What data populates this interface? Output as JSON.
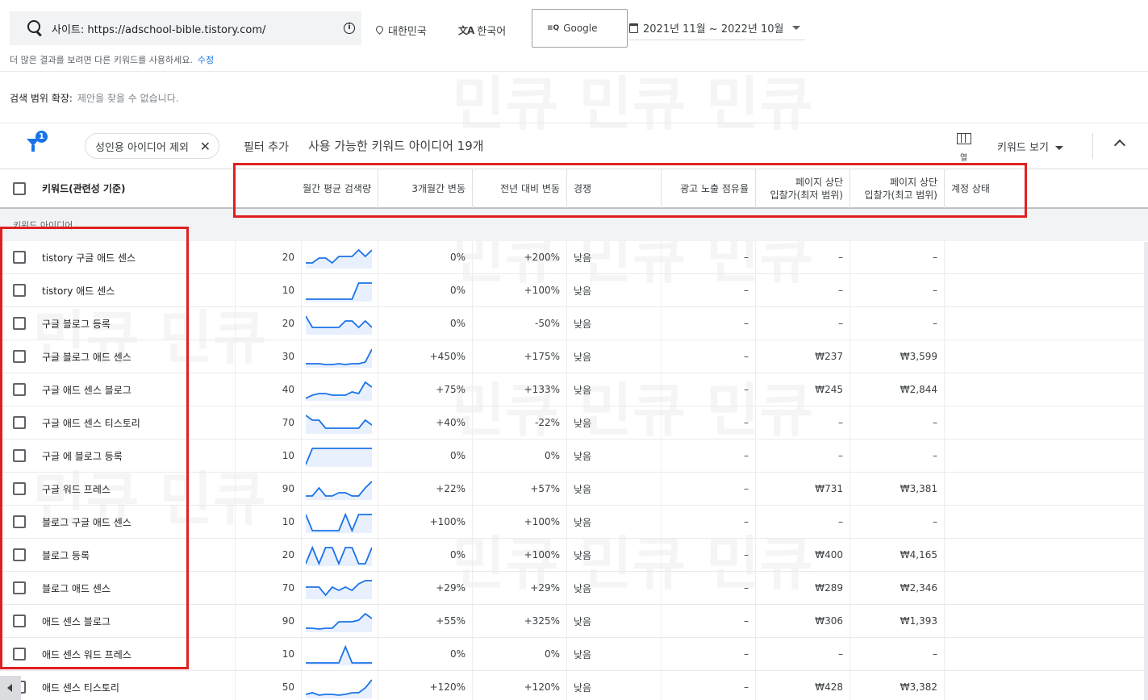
{
  "search": {
    "site_text": "사이트: https://adschool-bible.tistory.com/"
  },
  "location": "대한민국",
  "language": "한국어",
  "engine": "Google",
  "date_range": "2021년 11월 ~ 2022년 10월",
  "hint": {
    "text": "더 많은 결과를 보려면 다른 키워드를 사용하세요.",
    "link": "수정"
  },
  "expand": {
    "label": "검색 범위 확장:",
    "value": "제안을 찾을 수 없습니다."
  },
  "filterbar": {
    "badge": "1",
    "chip_label": "성인용 아이디어 제외",
    "add_filter": "필터 추가",
    "ideas_count": "사용 가능한 키워드 아이디어 19개",
    "columns_label": "열",
    "keyword_view": "키워드 보기"
  },
  "table": {
    "headers": {
      "keyword": "키워드(관련성 기준)",
      "volume": "월간 평균 검색량",
      "change_3m": "3개월간 변동",
      "change_yoy": "전년 대비 변동",
      "competition": "경쟁",
      "impression_share": "광고 노출 점유율",
      "bid_low_1": "페이지 상단",
      "bid_low_2": "입찰가(최저 범위)",
      "bid_high_1": "페이지 상단",
      "bid_high_2": "입찰가(최고 범위)",
      "account_status": "계정 상태"
    },
    "group_label": "키워드 아이디어",
    "rows": [
      {
        "keyword": "tistory 구글 애드 센스",
        "volume": "20",
        "change_3m": "0%",
        "change_yoy": "+200%",
        "competition": "낮음",
        "impression": "–",
        "bid_low": "–",
        "bid_high": "–",
        "trend": [
          0.2,
          0.2,
          0.5,
          0.5,
          0.2,
          0.6,
          0.6,
          0.6,
          1.0,
          0.6,
          1.0
        ]
      },
      {
        "keyword": "tistory 애드 센스",
        "volume": "10",
        "change_3m": "0%",
        "change_yoy": "+100%",
        "competition": "낮음",
        "impression": "–",
        "bid_low": "–",
        "bid_high": "–",
        "trend": [
          0,
          0,
          0,
          0,
          0,
          0,
          0,
          0,
          1,
          1,
          1
        ]
      },
      {
        "keyword": "구글 블로그 등록",
        "volume": "20",
        "change_3m": "0%",
        "change_yoy": "-50%",
        "competition": "낮음",
        "impression": "–",
        "bid_low": "–",
        "bid_high": "–",
        "trend": [
          1,
          0.3,
          0.3,
          0.3,
          0.3,
          0.3,
          0.7,
          0.7,
          0.3,
          0.7,
          0.3
        ]
      },
      {
        "keyword": "구글 블로그 애드 센스",
        "volume": "30",
        "change_3m": "+450%",
        "change_yoy": "+175%",
        "competition": "낮음",
        "impression": "–",
        "bid_low": "₩237",
        "bid_high": "₩3,599",
        "trend": [
          0.1,
          0.1,
          0.1,
          0.05,
          0.05,
          0.1,
          0.05,
          0.1,
          0.1,
          0.2,
          1.0
        ]
      },
      {
        "keyword": "구글 애드 센스 블로그",
        "volume": "40",
        "change_3m": "+75%",
        "change_yoy": "+133%",
        "competition": "낮음",
        "impression": "–",
        "bid_low": "₩245",
        "bid_high": "₩2,844",
        "trend": [
          0,
          0.2,
          0.3,
          0.3,
          0.2,
          0.2,
          0.2,
          0.4,
          0.3,
          1.0,
          0.7
        ]
      },
      {
        "keyword": "구글 애드 센스 티스토리",
        "volume": "70",
        "change_3m": "+40%",
        "change_yoy": "-22%",
        "competition": "낮음",
        "impression": "–",
        "bid_low": "–",
        "bid_high": "–",
        "trend": [
          1,
          0.7,
          0.7,
          0.2,
          0.2,
          0.2,
          0.2,
          0.2,
          0.2,
          0.7,
          0.4
        ]
      },
      {
        "keyword": "구글 에 블로그 등록",
        "volume": "10",
        "change_3m": "0%",
        "change_yoy": "0%",
        "competition": "낮음",
        "impression": "–",
        "bid_low": "–",
        "bid_high": "–",
        "trend": [
          0,
          1,
          1,
          1,
          1,
          1,
          1,
          1,
          1,
          1,
          1
        ]
      },
      {
        "keyword": "구글 워드 프레스",
        "volume": "90",
        "change_3m": "+22%",
        "change_yoy": "+57%",
        "competition": "낮음",
        "impression": "–",
        "bid_low": "₩731",
        "bid_high": "₩3,381",
        "trend": [
          0.1,
          0.1,
          0.6,
          0.1,
          0.1,
          0.3,
          0.3,
          0.1,
          0.1,
          0.6,
          1.0
        ]
      },
      {
        "keyword": "블로그 구글 애드 센스",
        "volume": "10",
        "change_3m": "+100%",
        "change_yoy": "+100%",
        "competition": "낮음",
        "impression": "–",
        "bid_low": "–",
        "bid_high": "–",
        "trend": [
          1,
          0,
          0,
          0,
          0,
          0,
          1,
          0,
          1,
          1,
          1
        ]
      },
      {
        "keyword": "블로그 등록",
        "volume": "20",
        "change_3m": "0%",
        "change_yoy": "+100%",
        "competition": "낮음",
        "impression": "–",
        "bid_low": "₩400",
        "bid_high": "₩4,165",
        "trend": [
          0,
          1,
          0,
          1,
          1,
          0,
          1,
          1,
          0,
          0,
          1
        ]
      },
      {
        "keyword": "블로그 애드 센스",
        "volume": "70",
        "change_3m": "+29%",
        "change_yoy": "+29%",
        "competition": "낮음",
        "impression": "–",
        "bid_low": "₩289",
        "bid_high": "₩2,346",
        "trend": [
          0.6,
          0.6,
          0.6,
          0.1,
          0.6,
          0.4,
          0.6,
          0.4,
          0.8,
          1.0,
          1.0
        ]
      },
      {
        "keyword": "애드 센스 블로그",
        "volume": "90",
        "change_3m": "+55%",
        "change_yoy": "+325%",
        "competition": "낮음",
        "impression": "–",
        "bid_low": "₩306",
        "bid_high": "₩1,393",
        "trend": [
          0.1,
          0.1,
          0.05,
          0.1,
          0.1,
          0.5,
          0.5,
          0.5,
          0.6,
          1.0,
          0.7
        ]
      },
      {
        "keyword": "애드 센스 워드 프레스",
        "volume": "10",
        "change_3m": "0%",
        "change_yoy": "0%",
        "competition": "낮음",
        "impression": "–",
        "bid_low": "–",
        "bid_high": "–",
        "trend": [
          0,
          0,
          0,
          0,
          0,
          0,
          1,
          0,
          0,
          0,
          0
        ]
      },
      {
        "keyword": "애드 센스 티스토리",
        "volume": "50",
        "change_3m": "+120%",
        "change_yoy": "+120%",
        "competition": "낮음",
        "impression": "–",
        "bid_low": "₩428",
        "bid_high": "₩3,382",
        "trend": [
          0.1,
          0.2,
          0.05,
          0.1,
          0.1,
          0.05,
          0.1,
          0.2,
          0.2,
          0.5,
          1.0
        ]
      }
    ]
  },
  "colors": {
    "accent": "#1a73e8",
    "highlight": "#e02020",
    "spark_fill": "#e8f0fe"
  }
}
